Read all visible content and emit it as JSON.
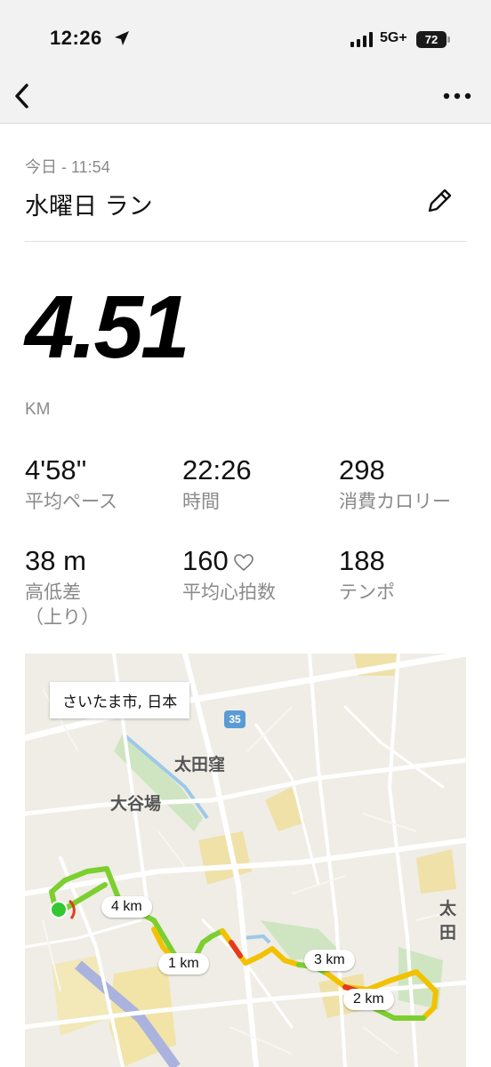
{
  "status_bar": {
    "time": "12:26",
    "network": "5G+",
    "battery": "72"
  },
  "nav": {
    "back_icon": "chevron-left-icon",
    "more_icon": "ellipsis-icon"
  },
  "header": {
    "subtitle": "今日 - 11:54",
    "title": "水曜日 ラン",
    "edit_icon": "pencil-icon"
  },
  "distance": {
    "value": "4.51",
    "unit": "KM"
  },
  "stats": [
    {
      "value": "4'58''",
      "label": "平均ペース"
    },
    {
      "value": "22:26",
      "label": "時間"
    },
    {
      "value": "298",
      "label": "消費カロリー"
    },
    {
      "value": "38 m",
      "label": "高低差\n（上り）"
    },
    {
      "value": "160",
      "label": "平均心拍数"
    },
    {
      "value": "188",
      "label": "テンポ"
    }
  ],
  "map": {
    "location": "さいたま市, 日本",
    "area_labels": [
      "太田窪",
      "大谷場",
      "太田"
    ],
    "road_number": "35",
    "km_markers": [
      "1 km",
      "2 km",
      "3 km",
      "4 km"
    ],
    "colors": {
      "route_good": "#7ccf2f",
      "route_mid": "#f2c200",
      "route_slow": "#e53a1e",
      "start": "#32c832"
    }
  }
}
